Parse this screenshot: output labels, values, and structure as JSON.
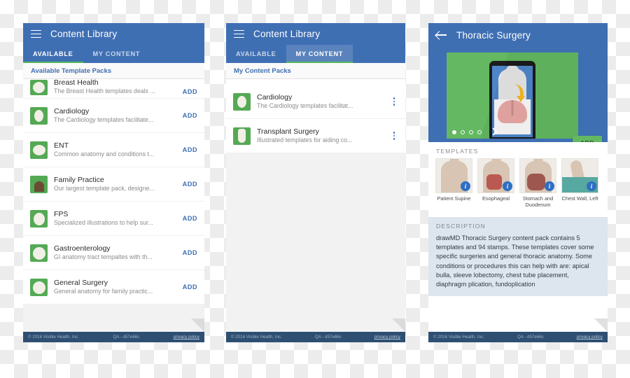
{
  "footer": {
    "copyright": "© 2016 Visible Health, Inc.",
    "build": "QA - d57e66c",
    "privacy": "privacy policy"
  },
  "panel1": {
    "title": "Content Library",
    "menu_icon": "hamburger-icon",
    "tabs": [
      {
        "label": "AVAILABLE",
        "active": true
      },
      {
        "label": "MY CONTENT",
        "active": false
      }
    ],
    "section_header": "Available Template Packs",
    "add_label": "ADD",
    "items": [
      {
        "title": "Breast Health",
        "subtitle": "The Breast Health templates deals ..."
      },
      {
        "title": "Cardiology",
        "subtitle": "The Cardiology templates facilitate..."
      },
      {
        "title": "ENT",
        "subtitle": "Common anatomy and conditions t..."
      },
      {
        "title": "Family Practice",
        "subtitle": "Our largest template pack, designe..."
      },
      {
        "title": "FPS",
        "subtitle": "Specialized illustrations to help sur..."
      },
      {
        "title": "Gastroenterology",
        "subtitle": "GI anatomy tract tempaltes with th..."
      },
      {
        "title": "General Surgery",
        "subtitle": "General anatomy for family practic..."
      }
    ]
  },
  "panel2": {
    "title": "Content Library",
    "menu_icon": "hamburger-icon",
    "tabs": [
      {
        "label": "AVAILABLE",
        "active": false
      },
      {
        "label": "MY CONTENT",
        "active": true
      }
    ],
    "section_header": "My Content Packs",
    "items": [
      {
        "title": "Cardiology",
        "subtitle": "The Cardiology templates facilitat..."
      },
      {
        "title": "Transplant Surgery",
        "subtitle": "Illustrated templates for aiding co..."
      }
    ]
  },
  "panel3": {
    "title": "Thoracic Surgery",
    "back_icon": "back-arrow-icon",
    "carousel": {
      "total_dots": 4,
      "active_index": 0,
      "next_icon": "chevron-right-icon"
    },
    "add_label": "ADD",
    "templates_label": "TEMPLATES",
    "templates": [
      {
        "caption": "Patient Supine",
        "info_icon": "info-icon"
      },
      {
        "caption": "Esophageal",
        "info_icon": "info-icon"
      },
      {
        "caption": "Stomach and Duodenum",
        "info_icon": "info-icon"
      },
      {
        "caption": "Chest Wall, Left",
        "info_icon": "info-icon"
      }
    ],
    "description_label": "DESCRIPTION",
    "description_text": "drawMD Thoracic Surgery content pack contains 5 templates and 94 stamps. These templates cover some specific surgeries and general thoracic anatomy. Some conditions or procedures this can help with are: apical bulla, sleeve lobectomy, chest tube placement, diaphragm plication, fundoplication"
  },
  "colors": {
    "header_blue": "#3f6fb3",
    "accent_green": "#63b861",
    "link_blue": "#3f6fb3",
    "footer_blue": "#2e4f72",
    "description_bg": "#dde5ee"
  }
}
